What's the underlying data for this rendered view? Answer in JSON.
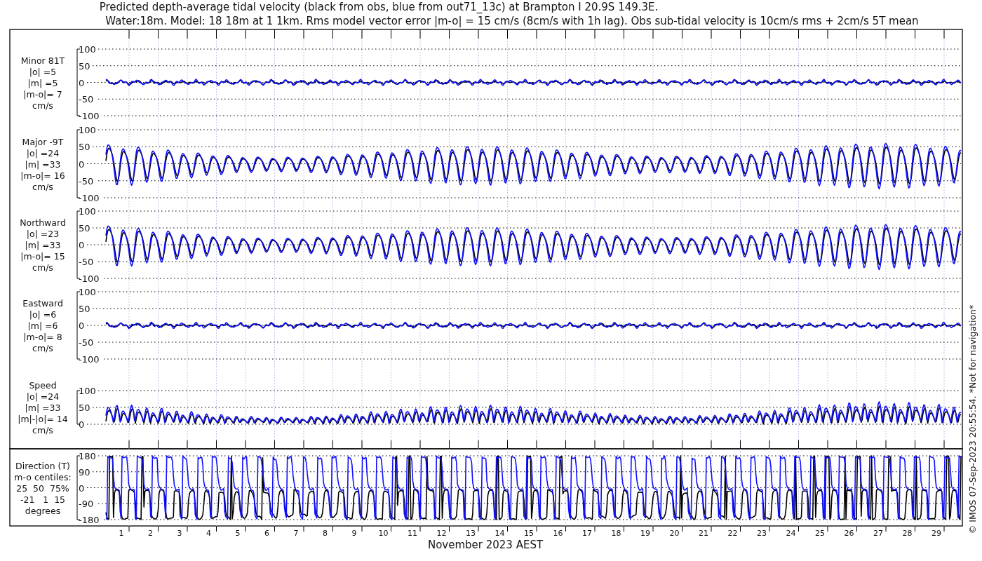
{
  "title_lines": [
    "Predicted depth-average tidal velocity (black from obs, blue from out71_13c) at Brampton I 20.9S 149.3E.",
    "Water:18m. Model: 18 18m at 1 1km. Rms model vector error |m-o| = 15 cm/s (8cm/s with 1h lag). Obs sub-tidal velocity is 10cm/s rms + 2cm/s 5T mean"
  ],
  "panels": [
    {
      "kind": "minor",
      "label_lines": [
        "Minor 81T",
        "|o| =5",
        "|m| =5",
        "|m-o|= 7",
        "cm/s"
      ],
      "yticks": [
        "100",
        "50",
        "0",
        "-50",
        "-100"
      ]
    },
    {
      "kind": "major",
      "label_lines": [
        "Major -9T",
        "|o| =24",
        "|m| =33",
        "|m-o|= 16",
        "cm/s"
      ],
      "yticks": [
        "100",
        "50",
        "0",
        "-50",
        "-100"
      ]
    },
    {
      "kind": "major",
      "label_lines": [
        "Northward",
        "|o| =23",
        "|m| =33",
        "|m-o|= 15",
        "cm/s"
      ],
      "yticks": [
        "100",
        "50",
        "0",
        "-50",
        "-100"
      ]
    },
    {
      "kind": "minor",
      "label_lines": [
        "Eastward",
        "|o| =6",
        "|m| =6",
        "|m-o|= 8",
        "cm/s"
      ],
      "yticks": [
        "100",
        "50",
        "0",
        "-50",
        "-100"
      ]
    },
    {
      "kind": "speed",
      "label_lines": [
        "Speed",
        "|o| =24",
        "|m| =33",
        "|m|-|o|= 14",
        "cm/s"
      ],
      "yticks": [
        "100",
        "50",
        "0"
      ]
    },
    {
      "kind": "direction",
      "label_lines": [
        "Direction (T)",
        "m-o centiles:",
        "25  50  75%",
        "-21   1  15",
        "degrees"
      ],
      "yticks": [
        "180",
        "90",
        "0",
        "-90",
        "-180"
      ]
    }
  ],
  "days": [
    "1",
    "2",
    "3",
    "4",
    "5",
    "6",
    "7",
    "8",
    "9",
    "10",
    "11",
    "12",
    "13",
    "14",
    "15",
    "16",
    "17",
    "18",
    "19",
    "20",
    "21",
    "22",
    "23",
    "24",
    "25",
    "26",
    "27",
    "28",
    "29"
  ],
  "xlabel": "November 2023 AEST",
  "side_note": "© IMOS 07-Sep-2023 20:55:54. *Not for navigation*"
}
